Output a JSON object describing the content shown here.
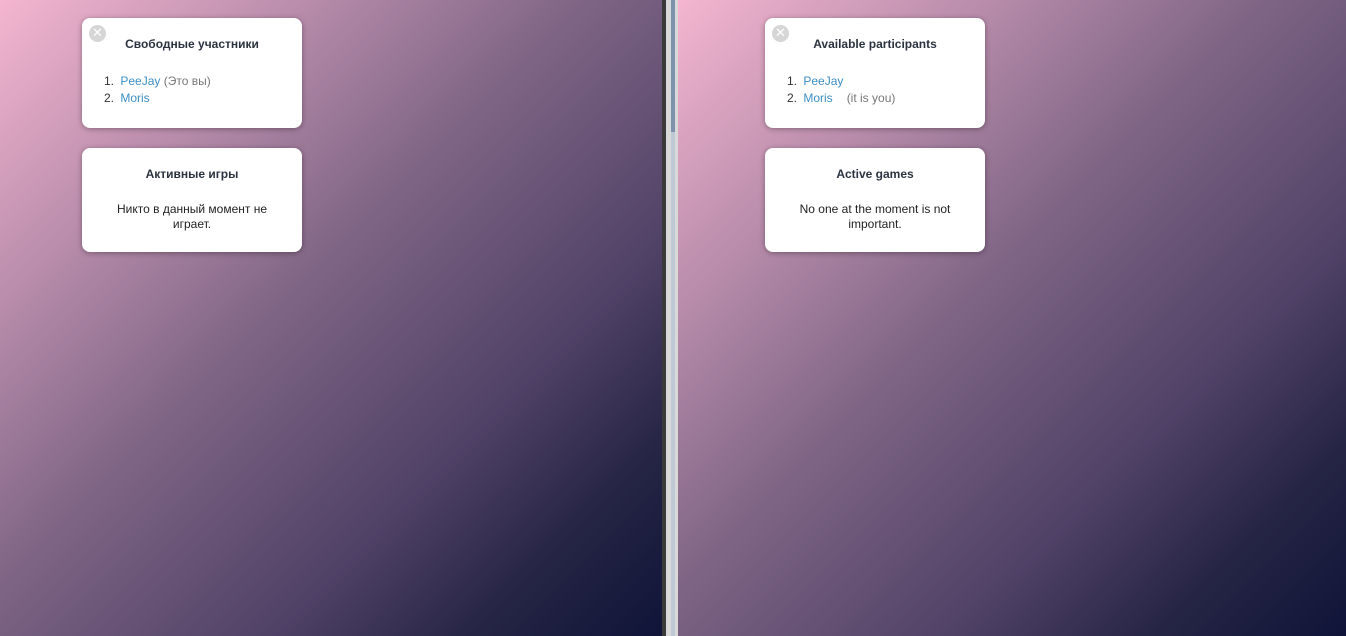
{
  "left_pane": {
    "players_card": {
      "close_icon": "close-icon",
      "title": "Свободные участники",
      "players": [
        {
          "num": "1.",
          "name": "PeeJay",
          "note": "(Это вы)"
        },
        {
          "num": "2.",
          "name": "Moris",
          "note": ""
        }
      ]
    },
    "games_card": {
      "title": "Активные игры",
      "empty_text": "Никто в данный момент не играет."
    }
  },
  "right_pane": {
    "players_card": {
      "close_icon": "close-icon",
      "title": "Available participants",
      "players": [
        {
          "num": "1.",
          "name": "PeeJay",
          "note": ""
        },
        {
          "num": "2.",
          "name": "Moris",
          "note": "(it is you)"
        }
      ]
    },
    "games_card": {
      "title": "Active games",
      "empty_text": "No one at the moment is not important."
    }
  },
  "colors": {
    "link": "#3f8fc4",
    "gradient_top": "#f4b6d0",
    "gradient_bottom": "#0f1438"
  }
}
